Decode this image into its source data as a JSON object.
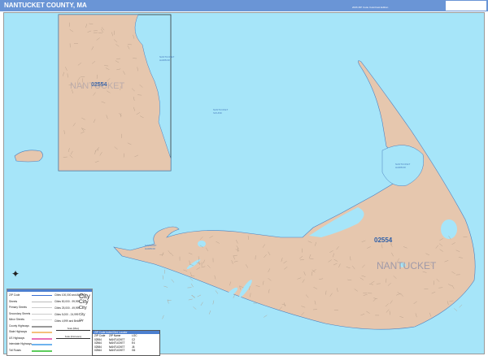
{
  "header": {
    "title": "NANTUCKET COUNTY, MA",
    "edition": "2026 ZIP Code ColorCast Edition",
    "logo_text": "Market MAPS"
  },
  "map": {
    "colors": {
      "water": "#a6e5f9",
      "land": "#e6c7ae",
      "header": "#6a95d6",
      "zip_label": "#2f5fa8"
    },
    "labels": {
      "zip": "02554",
      "city": "NANTUCKET",
      "inset_zip": "02554",
      "inset_city": "NANTUCKET",
      "madaket": "MADAKET HARBOR",
      "nantucket_harbor": "NANTUCKET HARBOR",
      "sound": "NANTUCKET SOUND",
      "ocean": "ATLANTIC OCEAN",
      "inset_harbor": "NANTUCKET HARBOR"
    }
  },
  "legend": {
    "title": "Legend",
    "items": [
      "ZIP Code",
      "Streets",
      "Primary Streets",
      "Secondary Streets",
      "Minor Streets",
      "County Highways",
      "State Highways",
      "US Highways",
      "Interstate Highways",
      "Toll Roads"
    ],
    "city_sizes": [
      {
        "range": "Cities 100,000 and Above",
        "sample": "City"
      },
      {
        "range": "Cities 50,000 - 99,999",
        "sample": "City"
      },
      {
        "range": "Cities 25,000 - 49,999",
        "sample": "City"
      },
      {
        "range": "Cities 5,000 - 24,999",
        "sample": "City"
      },
      {
        "range": "Cities 4,999 and Below",
        "sample": "City"
      }
    ],
    "scale_labels": [
      "Scale (Miles)",
      "Scale (Kilometers)"
    ]
  },
  "zip_table": {
    "title": "ZIP Code Index/Grid Locator",
    "headers": [
      "ZIP Code",
      "ZIP Name",
      "LOC"
    ],
    "rows": [
      [
        "02554",
        "NANTUCKET",
        "C2"
      ],
      [
        "02564",
        "NANTUCKET",
        "E4"
      ],
      [
        "02584",
        "NANTUCKET",
        "J6"
      ],
      [
        "02564",
        "NANTUCKET",
        "G6"
      ]
    ]
  }
}
